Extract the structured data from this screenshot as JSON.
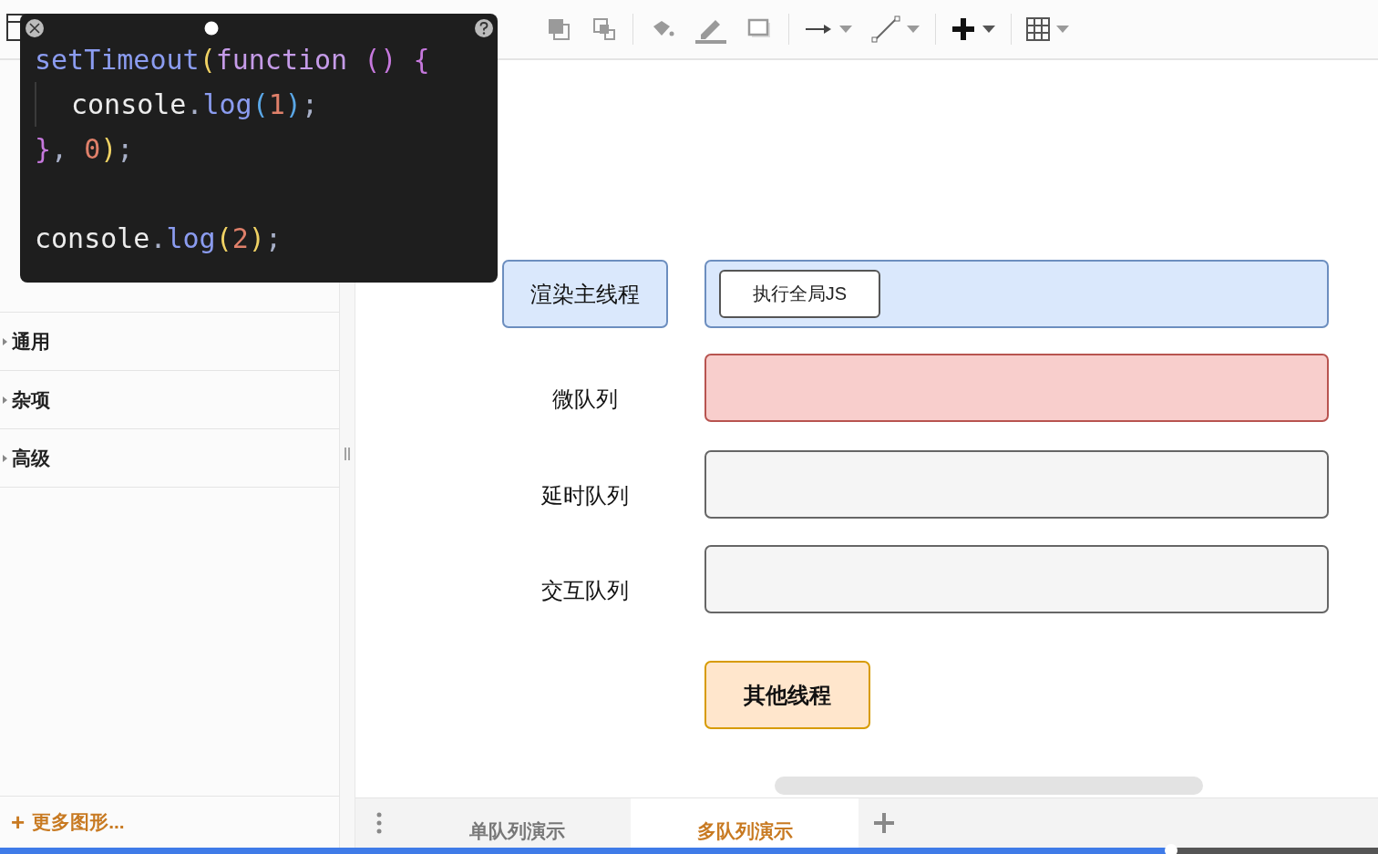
{
  "code_popup": {
    "lines": [
      {
        "indented": false,
        "tokens": [
          {
            "text": "setTimeout",
            "kind": "name"
          },
          {
            "text": "(",
            "kind": "bracket1"
          },
          {
            "text": "function ",
            "kind": "keyword"
          },
          {
            "text": "() ",
            "kind": "bracket2"
          },
          {
            "text": "{",
            "kind": "bracket2"
          }
        ]
      },
      {
        "indented": true,
        "tokens": [
          {
            "text": "console",
            "kind": "plain"
          },
          {
            "text": ".",
            "kind": "punct"
          },
          {
            "text": "log",
            "kind": "name"
          },
          {
            "text": "(",
            "kind": "bracket3"
          },
          {
            "text": "1",
            "kind": "number"
          },
          {
            "text": ")",
            "kind": "bracket3"
          },
          {
            "text": ";",
            "kind": "punct"
          }
        ]
      },
      {
        "indented": false,
        "tokens": [
          {
            "text": "}",
            "kind": "bracket2"
          },
          {
            "text": ", ",
            "kind": "punct"
          },
          {
            "text": "0",
            "kind": "number"
          },
          {
            "text": ")",
            "kind": "bracket1"
          },
          {
            "text": ";",
            "kind": "punct"
          }
        ]
      },
      {
        "indented": false,
        "tokens": [
          {
            "text": "console",
            "kind": "plain"
          },
          {
            "text": ".",
            "kind": "punct"
          },
          {
            "text": "log",
            "kind": "name"
          },
          {
            "text": "(",
            "kind": "bracket1"
          },
          {
            "text": "2",
            "kind": "number"
          },
          {
            "text": ")",
            "kind": "bracket1"
          },
          {
            "text": ";",
            "kind": "punct"
          }
        ]
      }
    ]
  },
  "sidebar": {
    "sections": [
      {
        "label": "通用",
        "expanded": false
      },
      {
        "label": "杂项",
        "expanded": false
      },
      {
        "label": "高级",
        "expanded": false
      }
    ],
    "more_shapes": {
      "icon": "+",
      "label": "更多图形..."
    }
  },
  "diagram": {
    "shapes": [
      {
        "kind": "block",
        "text": "渲染主线程",
        "color": "#dae8fc"
      },
      {
        "kind": "lane",
        "color": "#dae8fc",
        "items": [
          "执行全局JS"
        ]
      },
      {
        "kind": "label",
        "text": "微队列"
      },
      {
        "kind": "lane",
        "color": "#f8cecc"
      },
      {
        "kind": "label",
        "text": "延时队列"
      },
      {
        "kind": "lane",
        "color": "#f5f5f5"
      },
      {
        "kind": "label",
        "text": "交互队列"
      },
      {
        "kind": "lane",
        "color": "#f5f5f5"
      },
      {
        "kind": "block",
        "text": "其他线程",
        "color": "#ffe6cc"
      }
    ]
  },
  "page_tabs": [
    {
      "label": "单队列演示",
      "selected": false
    },
    {
      "label": "多队列演示",
      "selected": true
    }
  ],
  "video_progress": {
    "level": 0.85
  }
}
